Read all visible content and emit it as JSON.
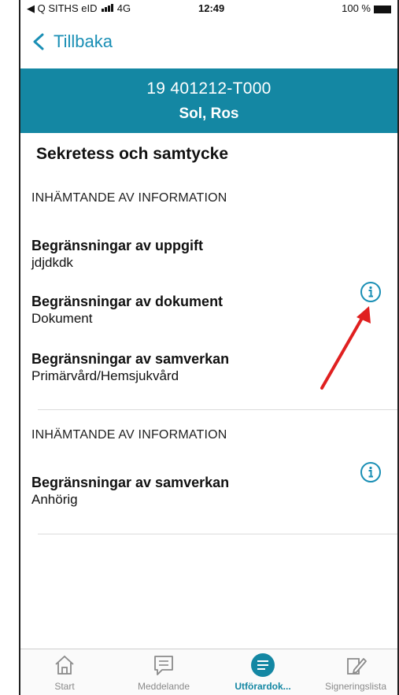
{
  "status_bar": {
    "carrier": "◀ Q SITHS eID",
    "network": "4G",
    "time": "12:49",
    "battery": "100 %"
  },
  "nav": {
    "back_label": "Tillbaka"
  },
  "patient": {
    "id": "19 401212-T000",
    "name": "Sol, Ros"
  },
  "page_title": "Sekretess och samtycke",
  "groups": [
    {
      "heading": "INHÄMTANDE AV INFORMATION",
      "items": [
        {
          "label": "Begränsningar av uppgift",
          "value": "jdjdkdk"
        },
        {
          "label": "Begränsningar av dokument",
          "value": "Dokument"
        },
        {
          "label": "Begränsningar av samverkan",
          "value": "Primärvård/Hemsjukvård"
        }
      ]
    },
    {
      "heading": "INHÄMTANDE AV INFORMATION",
      "items": [
        {
          "label": "Begränsningar av samverkan",
          "value": "Anhörig"
        }
      ]
    }
  ],
  "tabs": [
    {
      "label": "Start",
      "icon": "home-icon",
      "active": false
    },
    {
      "label": "Meddelande",
      "icon": "message-icon",
      "active": false
    },
    {
      "label": "Utförardok...",
      "icon": "document-list-icon",
      "active": true
    },
    {
      "label": "Signeringslista",
      "icon": "signature-icon",
      "active": false
    }
  ],
  "colors": {
    "accent": "#1487a3",
    "link": "#1a8fb5",
    "annotation": "#e02020"
  }
}
